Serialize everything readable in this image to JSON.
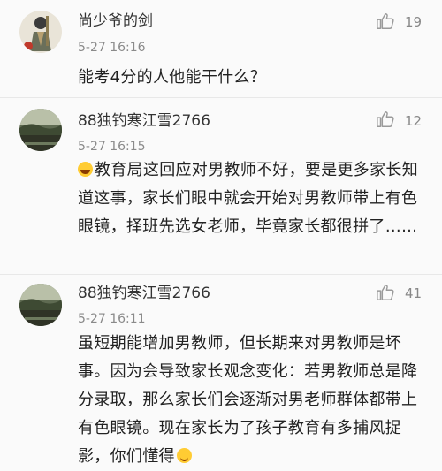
{
  "comments": [
    {
      "username": "尚少爷的剑",
      "timestamp": "5-27 16:16",
      "likes": "19",
      "avatar_icon": "warrior-portrait-icon",
      "text": "能考4分的人他能干什么？"
    },
    {
      "username": "88独钓寒江雪2766",
      "timestamp": "5-27 16:15",
      "likes": "12",
      "avatar_icon": "landscape-photo-icon",
      "emoji": "laughing-emoji-icon",
      "text": "教育局这回应对男教师不好，要是更多家长知道这事，家长们眼中就会开始对男教师带上有色眼镜，择班先选女老师，毕竟家长都很拼了……"
    },
    {
      "username": "88独钓寒江雪2766",
      "timestamp": "5-27 16:11",
      "likes": "41",
      "avatar_icon": "landscape-photo-icon",
      "emoji": "shy-smile-emoji-icon",
      "text": "虽短期能增加男教师，但长期来对男教师是坏事。因为会导致家长观念变化：若男教师总是降分录取，那么家长们会逐渐对男老师群体都带上有色眼镜。现在家长为了孩子教育有多捕风捉影，你们懂得"
    }
  ],
  "colors": {
    "background": "#fafafa",
    "text": "#222222",
    "meta": "#8a8a8a",
    "like_icon": "#9a9a9a",
    "divider": "#e8e8e8"
  },
  "icons": {
    "like": "thumbs-up-icon"
  }
}
